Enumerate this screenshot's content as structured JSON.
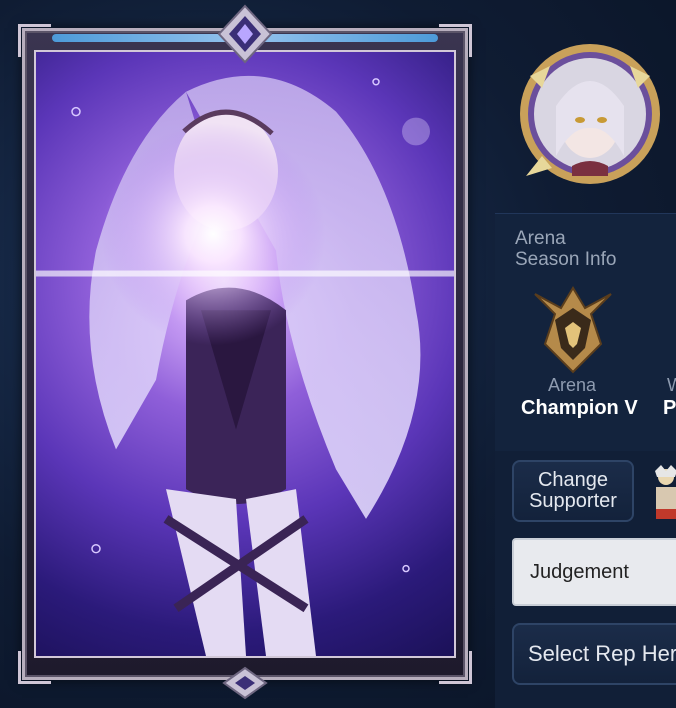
{
  "arena": {
    "season_title": "Arena\nSeason Info",
    "rank_label": "Arena",
    "rank_value": "Champion V",
    "rank2_label": "W",
    "rank2_value": "Pl"
  },
  "buttons": {
    "change_supporter": "Change\nSupporter",
    "select_rep_hero": "Select Rep Hero"
  },
  "judgement_field": {
    "value": "Judgement"
  },
  "colors": {
    "accent_blue": "#4fa6e8",
    "panel_bg": "#13233d",
    "card_purple": "#5b36b8",
    "gold": "#c9a15a"
  }
}
